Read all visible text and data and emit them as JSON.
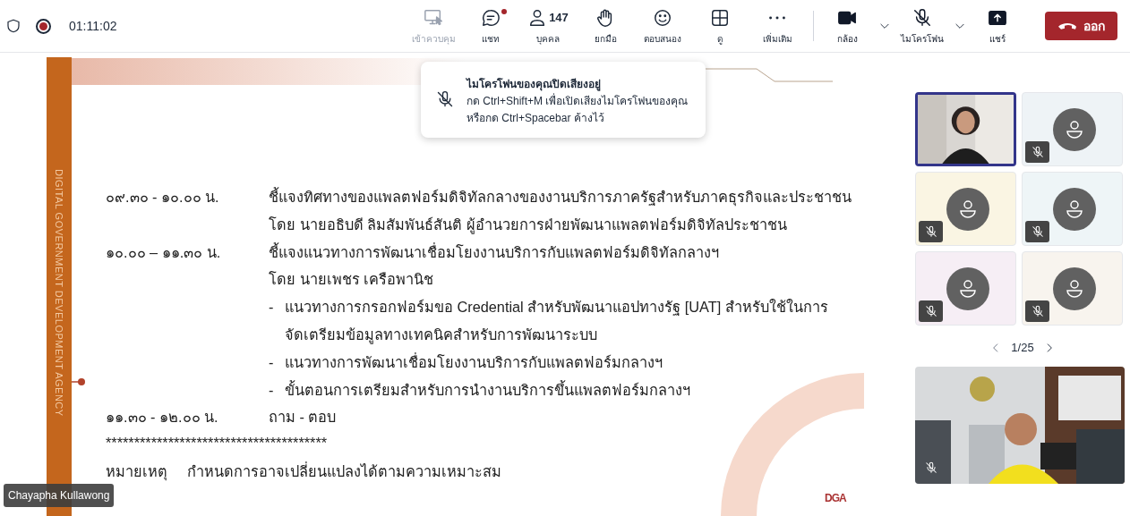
{
  "meeting_bar": {
    "timer": "01:11:02",
    "recording": true,
    "actions": [
      {
        "kind": "control",
        "label": "เข้าควบคุม",
        "disabled": true
      },
      {
        "kind": "chat",
        "label": "แชท",
        "disabled": false,
        "unread": true
      },
      {
        "kind": "people",
        "label": "บุคคล",
        "disabled": false,
        "count": "147"
      },
      {
        "kind": "hand",
        "label": "ยกมือ",
        "disabled": false
      },
      {
        "kind": "react",
        "label": "ตอบสนอง",
        "disabled": false
      },
      {
        "kind": "view",
        "label": "ดู",
        "disabled": false
      },
      {
        "kind": "more",
        "label": "เพิ่มเติม",
        "disabled": false
      }
    ],
    "devices": [
      {
        "kind": "camera",
        "label": "กล้อง",
        "muted": false,
        "has_menu": true
      },
      {
        "kind": "mic",
        "label": "ไมโครโฟน",
        "muted": true,
        "has_menu": true
      },
      {
        "kind": "share",
        "label": "แชร์",
        "muted": false,
        "has_menu": false
      }
    ],
    "leave_button": "ออก"
  },
  "toast": {
    "title": "ไมโครโฟนของคุณปิดเสียงอยู่",
    "message": "กด Ctrl+Shift+M เพื่อเปิดเสียงไมโครโฟนของคุณ หรือกด Ctrl+Spacebar ค้างไว้"
  },
  "slide": {
    "side_text": "DIGITAL GOVERNMENT DEVELOPMENT AGENCY",
    "schedule": [
      {
        "time": "๐๙.๓๐ - ๑๐.๐๐ น.",
        "lines": [
          {
            "kind": "text",
            "text": "ชี้แจงทิศทางของแพลตฟอร์มดิจิทัลกลางของงานบริการภาครัฐสำหรับภาคธุรกิจและประชาชน"
          },
          {
            "kind": "text",
            "text": "โดย นายอธิบดี ลิมสัมพันธ์สันติ ผู้อำนวยการฝ่ายพัฒนาแพลตฟอร์มดิจิทัลประชาชน"
          }
        ]
      },
      {
        "time": "๑๐.๐๐ – ๑๑.๓๐ น.",
        "lines": [
          {
            "kind": "text",
            "text": "ชี้แจงแนวทางการพัฒนาเชื่อมโยงงานบริการกับแพลตฟอร์มดิจิทัลกลางฯ"
          },
          {
            "kind": "text",
            "text": "โดย นายเพชร เครือพานิช"
          },
          {
            "kind": "bullet",
            "marker": "-",
            "text": "แนวทางการกรอกฟอร์มขอ Credential สำหรับพัฒนาแอปทางรัฐ [UAT] สำหรับใช้ในการ"
          },
          {
            "kind": "continuation",
            "text": "จัดเตรียมข้อมูลทางเทคนิคสำหรับการพัฒนาระบบ"
          },
          {
            "kind": "bullet",
            "marker": "-",
            "text": "แนวทางการพัฒนาเชื่อมโยงงานบริการกับแพลตฟอร์มกลางฯ"
          },
          {
            "kind": "bullet",
            "marker": "-",
            "text": "ขั้นตอนการเตรียมสำหรับการนำงานบริการขึ้นแพลตฟอร์มกลางฯ"
          }
        ]
      },
      {
        "time": "๑๑.๓๐ - ๑๒.๐๐ น.",
        "lines": [
          {
            "kind": "text",
            "text": "ถาม - ตอบ"
          }
        ]
      }
    ],
    "separator": "***************************************",
    "note_label": "หมายเหตุ",
    "note": "กำหนดการอาจเปลี่ยนแปลงได้ตามความเหมาะสม",
    "logo": "DGA"
  },
  "presenter_name": "Chayapha Kullawong",
  "participants": [
    {
      "kind": "video",
      "muted": false,
      "selected": true,
      "color": "#d9d6d2"
    },
    {
      "kind": "avatar",
      "muted": true,
      "selected": false,
      "color": "#eef3f6"
    },
    {
      "kind": "avatar",
      "muted": true,
      "selected": false,
      "color": "#faf5e3"
    },
    {
      "kind": "avatar",
      "muted": true,
      "selected": false,
      "color": "#eef5f7"
    },
    {
      "kind": "avatar",
      "muted": true,
      "selected": false,
      "color": "#f6eef5"
    },
    {
      "kind": "avatar",
      "muted": true,
      "selected": false,
      "color": "#f8f4ee"
    }
  ],
  "pager": "1/25",
  "self_view": {
    "muted": true
  }
}
